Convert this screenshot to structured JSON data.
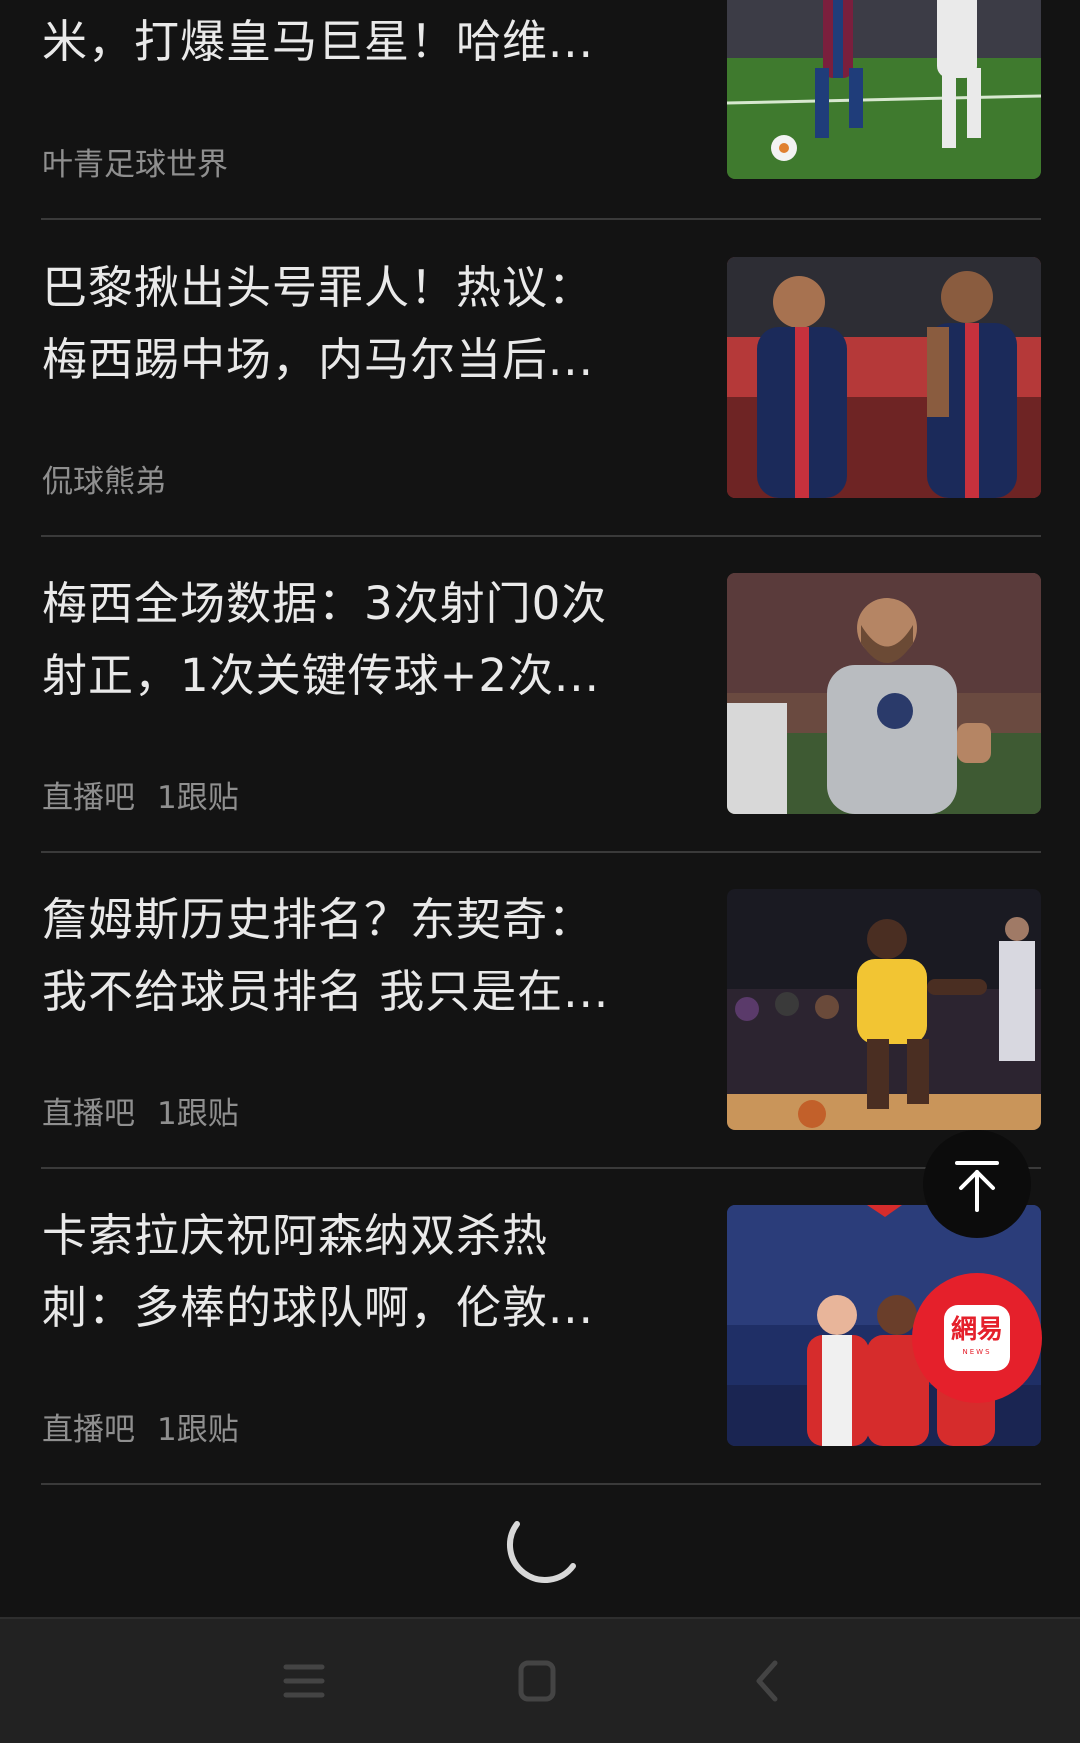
{
  "feed": {
    "items": [
      {
        "title_lines": [
          "米，打爆皇马巨星！哈维..."
        ],
        "source": "叶青足球世界",
        "replies": "",
        "image": "photo-barcelona-vs-real-madrid"
      },
      {
        "title_lines": [
          "巴黎揪出头号罪人！热议：",
          "梅西踢中场，内马尔当后..."
        ],
        "source": "侃球熊弟",
        "replies": "",
        "image": "photo-messi-and-neymar-psg"
      },
      {
        "title_lines": [
          "梅西全场数据：3次射门0次",
          "射正，1次关键传球+2次..."
        ],
        "source": "直播吧",
        "replies": "1跟贴",
        "image": "photo-messi-psg-grey-kit"
      },
      {
        "title_lines": [
          "詹姆斯历史排名？东契奇：",
          "我不给球员排名 我只是在..."
        ],
        "source": "直播吧",
        "replies": "1跟贴",
        "image": "photo-lebron-lakers-dribbling"
      },
      {
        "title_lines": [
          "卡索拉庆祝阿森纳双杀热",
          "刺：多棒的球队啊，伦敦..."
        ],
        "source": "直播吧",
        "replies": "1跟贴",
        "image": "photo-arsenal-players-celebrating"
      }
    ]
  },
  "floating": {
    "back_to_top_icon": "arrow-up-to-top-icon",
    "app_logo_text": "網易",
    "app_logo_sub": "NEWS",
    "app_logo_color": "#e5202b"
  },
  "loading_icon": "loading-spinner-icon",
  "system_nav": {
    "menu_icon": "menu-icon",
    "home_icon": "home-icon",
    "back_icon": "back-icon"
  },
  "colors": {
    "background": "#131313",
    "title_text": "#e9e9e9",
    "meta_text": "#8f8f8f",
    "divider": "#3a3a3a",
    "navbar": "#222222"
  }
}
